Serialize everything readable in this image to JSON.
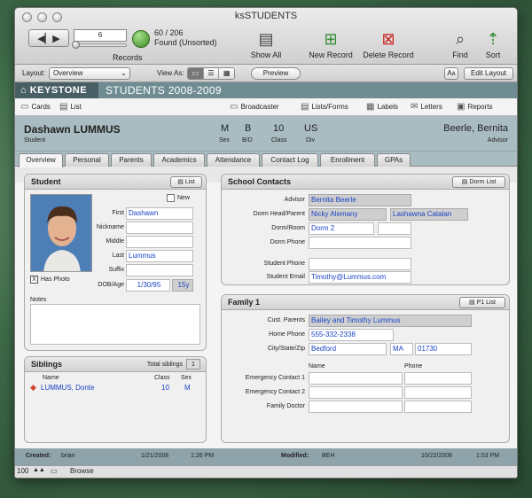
{
  "window": {
    "title": "ksSTUDENTS"
  },
  "toolbar": {
    "record_number": "6",
    "records_found": "60 / 206",
    "found_state": "Found (Unsorted)",
    "records_label": "Records",
    "show_all": "Show All",
    "new_record": "New Record",
    "delete_record": "Delete Record",
    "find": "Find",
    "sort": "Sort"
  },
  "layoutbar": {
    "layout_label": "Layout:",
    "layout_value": "Overview",
    "view_as_label": "View As:",
    "preview": "Preview",
    "font_size": "Aᴀ",
    "edit_layout": "Edit Layout"
  },
  "banner": {
    "logo": "KEYSTONE",
    "title": "STUDENTS 2008-2009"
  },
  "navbar": {
    "cards": "Cards",
    "list": "List",
    "broadcaster": "Broadcaster",
    "lists_forms": "Lists/Forms",
    "labels": "Labels",
    "letters": "Letters",
    "reports": "Reports"
  },
  "student_header": {
    "name": "Dashawn LUMMUS",
    "name_label": "Student",
    "sex": "M",
    "sex_label": "Sex",
    "bd": "B",
    "bd_label": "B/D",
    "class": "10",
    "class_label": "Class",
    "div": "US",
    "div_label": "Div",
    "advisor": "Beerle, Bernita",
    "advisor_label": "Advisor"
  },
  "tabs": [
    "Overview",
    "Personal",
    "Parents",
    "Academics",
    "Attendance",
    "Contact Log",
    "Enrollment",
    "GPAs"
  ],
  "student_panel": {
    "title": "Student",
    "list_btn": "List",
    "new_label": "New",
    "first_label": "First",
    "first": "Dashawn",
    "nickname_label": "Nickname",
    "nickname": "",
    "middle_label": "Middle",
    "middle": "",
    "last_label": "Last",
    "last": "Lummus",
    "suffix_label": "Suffix",
    "suffix": "",
    "has_photo_label": "Has Photo",
    "has_photo_check": "X",
    "dob_label": "DOB/Age",
    "dob": "1/30/95",
    "age": "15y",
    "notes_label": "Notes"
  },
  "siblings_panel": {
    "title": "Siblings",
    "total_label": "Total siblings",
    "total": "1",
    "col_name": "Name",
    "col_class": "Class",
    "col_sex": "Sex",
    "rows": [
      {
        "name": "LUMMUS, Donte",
        "class": "10",
        "sex": "M"
      }
    ]
  },
  "contacts_panel": {
    "title": "School Contacts",
    "dorm_list_btn": "Dorm List",
    "advisor_label": "Advisor",
    "advisor": "Bernita Beerle",
    "dorm_head_label": "Dorm Head/Parent",
    "dorm_head_1": "Nicky Alemany",
    "dorm_head_2": "Lashawna Catalan",
    "dorm_room_label": "Dorm/Room",
    "dorm_room": "Dorm 2",
    "room": "",
    "dorm_phone_label": "Dorm Phone",
    "dorm_phone": "",
    "student_phone_label": "Student Phone",
    "student_phone": "",
    "student_email_label": "Student Email",
    "student_email": "Timothy@Lummus.com"
  },
  "family_panel": {
    "title": "Family 1",
    "p1_list_btn": "P1 List",
    "cust_parents_label": "Cust. Parents",
    "cust_parents": "Bailey and Timothy Lummus",
    "home_phone_label": "Home Phone",
    "home_phone": "555-332-2338",
    "city_label": "City/State/Zip",
    "city": "Bedford",
    "state": "MA",
    "zip": "01730",
    "col_name": "Name",
    "col_phone": "Phone",
    "emergency1_label": "Emergency Contact 1",
    "emergency2_label": "Emergency Contact 2",
    "doctor_label": "Family Doctor"
  },
  "status": {
    "created_label": "Created:",
    "created_by": "brian",
    "created_date": "1/21/2008",
    "created_time": "1:26 PM",
    "modified_label": "Modified:",
    "modified_by": "BEH",
    "modified_date": "10/22/2008",
    "modified_time": "1:53 PM"
  },
  "bottom": {
    "zoom": "100",
    "mode": "Browse"
  },
  "colors": {
    "banner": "#6f8c93",
    "header": "#a9bcc1",
    "link": "#1b43c5"
  }
}
